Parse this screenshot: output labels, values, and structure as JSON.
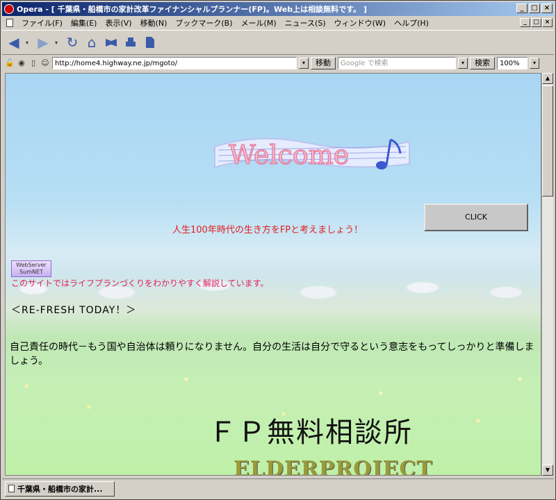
{
  "window": {
    "title": "Opera - [ 千葉県・船橋市の家計改革ファイナンシャルプランナー(FP)。Web上は相談無料です。 ]",
    "btn_min": "_",
    "btn_max": "□",
    "btn_close": "×"
  },
  "menu": {
    "items": [
      "ファイル(F)",
      "編集(E)",
      "表示(V)",
      "移動(N)",
      "ブックマーク(B)",
      "メール(M)",
      "ニュース(S)",
      "ウィンドウ(W)",
      "ヘルプ(H)"
    ]
  },
  "toolbar": {
    "back_icon": "◀",
    "forward_icon": "▶",
    "reload_icon": "↻",
    "home_icon": "⌂",
    "dropdown_icon": "▾"
  },
  "address": {
    "url": "http://home4.highway.ne.jp/mgoto/",
    "go_label": "移動",
    "search_placeholder": "Google で検索",
    "search_label": "検索",
    "zoom": "100%"
  },
  "page": {
    "welcome_text": "Welcome",
    "click_label": "CLICK",
    "tagline": "人生100年時代の生き方をFPと考えましょう！",
    "server_badge_line1": "WebServer",
    "server_badge_line2": "SumNET",
    "site_desc": "このサイトではライフプランづくりをわかりやすく解説しています。",
    "refresh": "＜RE-FRESH  TODAY！＞",
    "paragraph": "自己責任の時代－もう国や自治体は頼りになりません。自分の生活は自分で守るという意志をもってしっかりと準備しましょう。",
    "fp_title": "ＦＰ無料相談所",
    "elder": "ELDERPROJECT"
  },
  "status": {
    "tab_title": "千葉県・船橋市の家計..."
  },
  "colors": {
    "title_gradient_start": "#0a246a",
    "tagline_red": "#e02020"
  }
}
